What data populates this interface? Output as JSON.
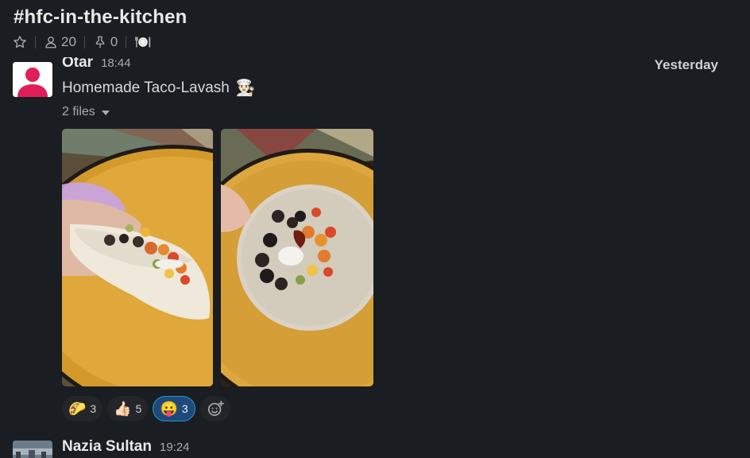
{
  "channel": {
    "title": "#hfc-in-the-kitchen",
    "members_count": "20",
    "pins_count": "0",
    "bookmark_icon": "plate-cutlery-icon"
  },
  "message": {
    "author": "Otar",
    "time": "18:44",
    "day_label": "Yesterday",
    "text": "Homemade Taco-Lavash",
    "text_emoji": "👨🏻‍🍳",
    "files_label": "2 files",
    "reactions": [
      {
        "emoji": "🌮",
        "count": "3",
        "active": false
      },
      {
        "emoji": "👍🏻",
        "count": "5",
        "active": false
      },
      {
        "emoji": "😛",
        "count": "3",
        "active": true
      }
    ]
  },
  "next_message": {
    "author": "Nazia Sultan",
    "time": "19:24"
  },
  "colors": {
    "background": "#1a1d21",
    "active_reaction": "#1d4a7a",
    "active_reaction_border": "#1d9bd1",
    "avatar_red": "#e01e5a"
  }
}
